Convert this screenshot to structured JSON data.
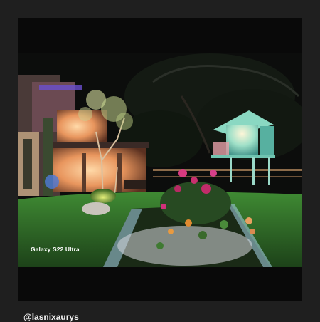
{
  "photo": {
    "watermark": "Galaxy S22 Ultra"
  },
  "caption": {
    "handle": "@lasnixaurys"
  },
  "colors": {
    "page_background": "#1f1f1f",
    "sky": "#0a0a0a",
    "lawn": "#2f6b2a",
    "house_glow": "#f5a86a",
    "treehouse_glow": "#bff0e0",
    "flowers": "#c0306a"
  }
}
